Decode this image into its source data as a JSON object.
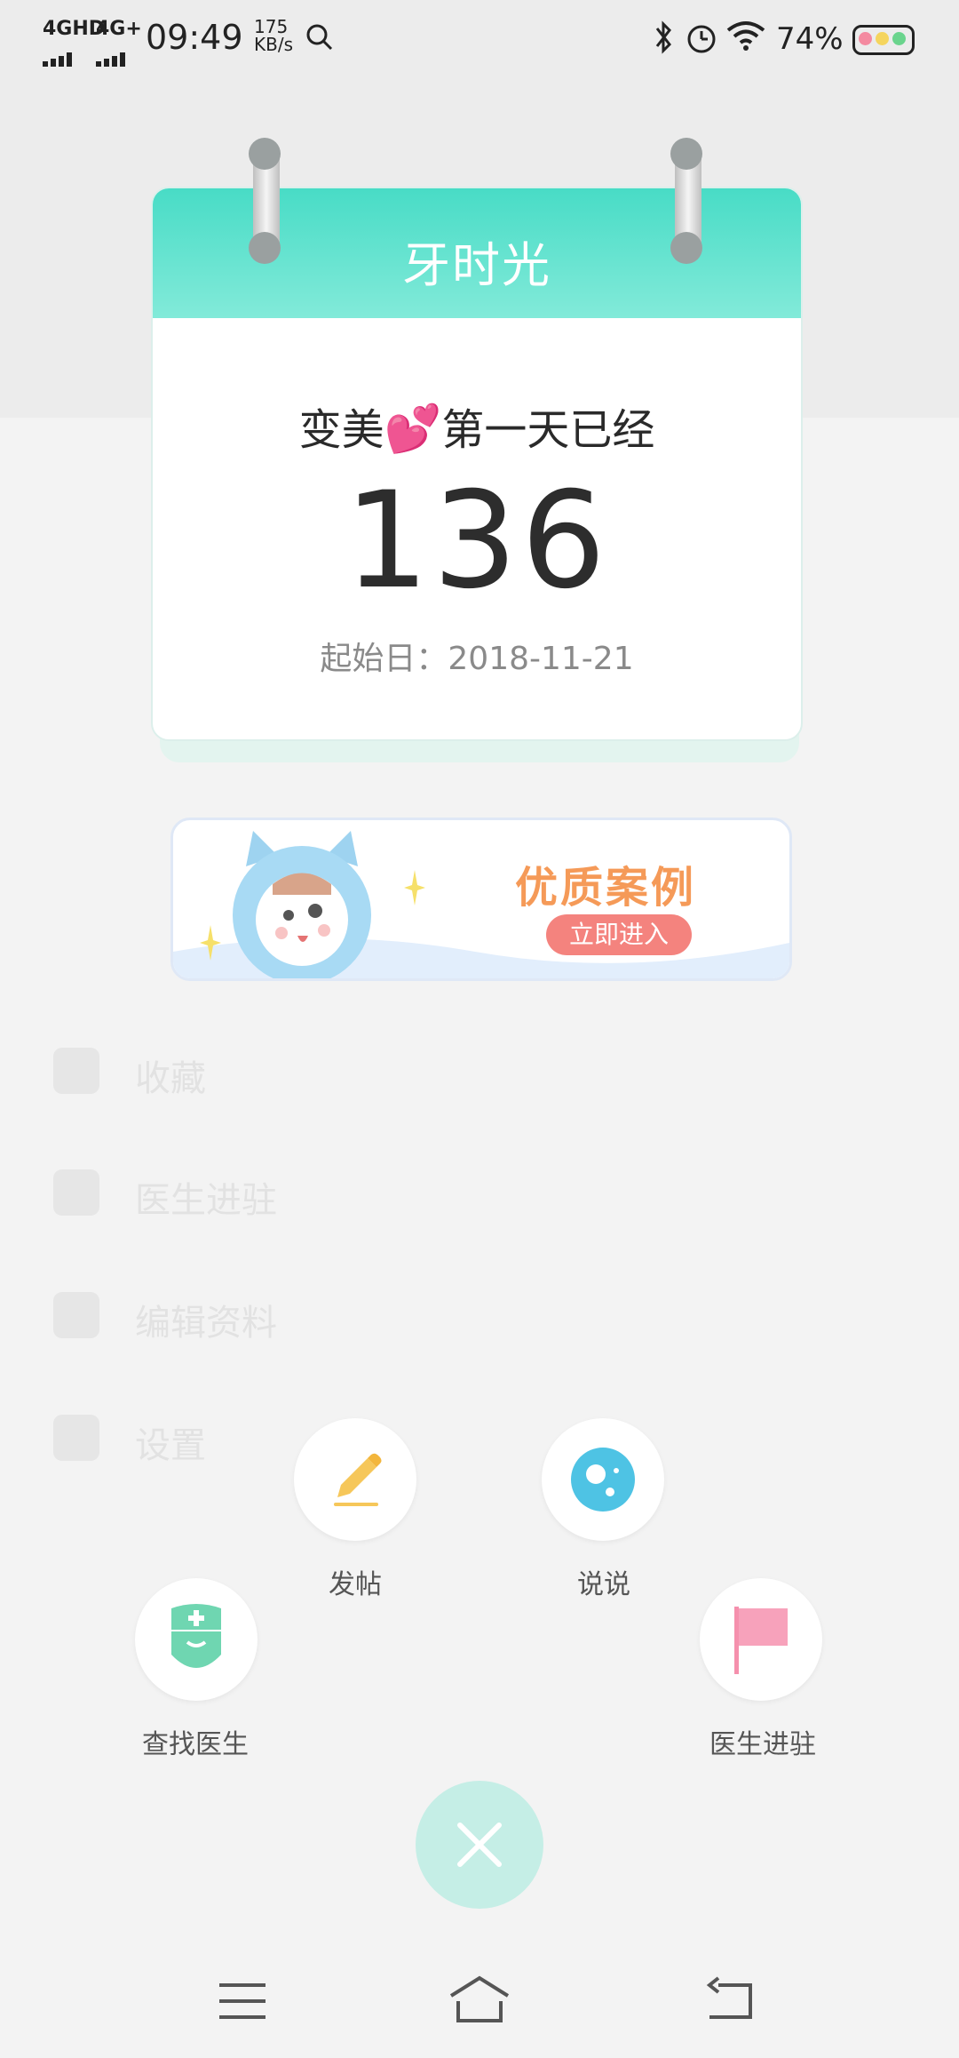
{
  "status_bar": {
    "network1": "4GHD",
    "network2": "4G+",
    "time": "09:49",
    "speed_value": "175",
    "speed_unit": "KB/s",
    "battery": "74%"
  },
  "background": {
    "menu": [
      {
        "label": "收藏",
        "icon": "star-icon"
      },
      {
        "label": "医生进驻",
        "icon": "flag-icon"
      },
      {
        "label": "编辑资料",
        "icon": "edit-icon"
      },
      {
        "label": "设置",
        "icon": "gear-icon"
      }
    ]
  },
  "calendar": {
    "title": "牙时光",
    "subtitle_before": "变美",
    "heart": "💕",
    "subtitle_after": "第一天已经",
    "days": "136",
    "start_date": "起始日：2018-11-21"
  },
  "banner": {
    "title": "优质案例",
    "button": "立即进入"
  },
  "actions": {
    "post": "发帖",
    "talk": "说说",
    "find_doctor": "查找医生",
    "doctor_join": "医生进驻"
  },
  "colors": {
    "calendar_header": "#48dcc6",
    "banner_title": "#f59a58",
    "banner_button": "#f4837e",
    "close_button": "#c5eee6"
  }
}
